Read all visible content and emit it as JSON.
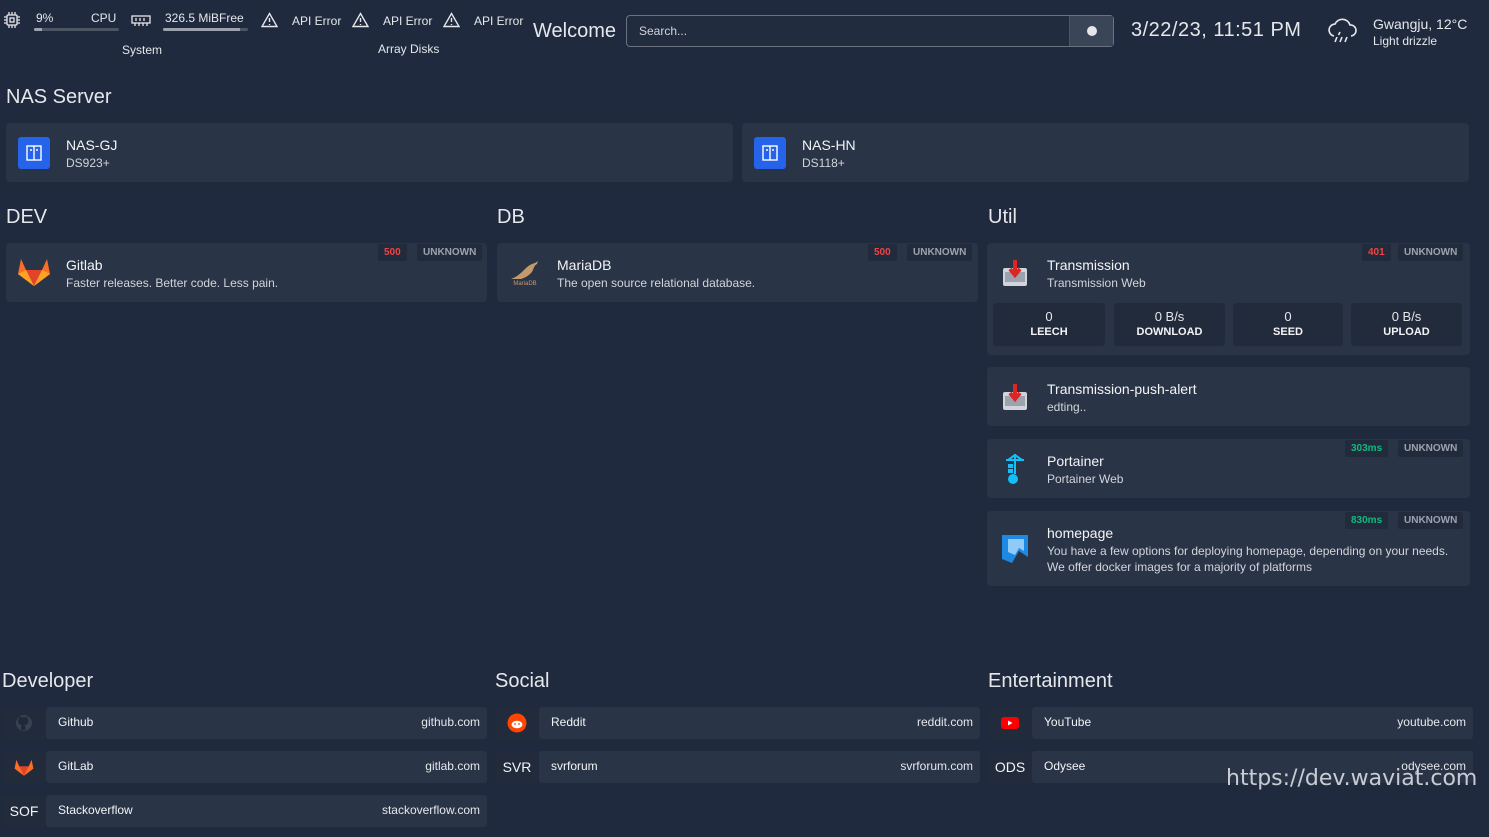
{
  "header": {
    "cpu_percent": "9%",
    "cpu_label": "CPU",
    "cpu_usage_fraction": 0.09,
    "mem_free": "326.5 MiBFree",
    "mem_usage_fraction": 0.9,
    "system_label": "System",
    "api_errors": [
      "API Error",
      "API Error",
      "API Error"
    ],
    "array_disks_label": "Array Disks",
    "greeting": "Welcome",
    "search_placeholder": "Search...",
    "datetime": "3/22/23, 11:51 PM",
    "weather_location": "Gwangju, 12°C",
    "weather_condition": "Light drizzle"
  },
  "nas": {
    "title": "NAS Server",
    "items": [
      {
        "name": "NAS-GJ",
        "model": "DS923+"
      },
      {
        "name": "NAS-HN",
        "model": "DS118+"
      }
    ]
  },
  "dev": {
    "title": "DEV",
    "items": [
      {
        "name": "Gitlab",
        "desc": "Faster releases. Better code. Less pain.",
        "code": "500",
        "status": "UNKNOWN"
      }
    ]
  },
  "db": {
    "title": "DB",
    "items": [
      {
        "name": "MariaDB",
        "desc": "The open source relational database.",
        "code": "500",
        "status": "UNKNOWN",
        "logo_text": "MariaDB"
      }
    ]
  },
  "util": {
    "title": "Util",
    "transmission": {
      "name": "Transmission",
      "desc": "Transmission Web",
      "code": "401",
      "status": "UNKNOWN",
      "stats": [
        {
          "value": "0",
          "label": "LEECH"
        },
        {
          "value": "0 B/s",
          "label": "DOWNLOAD"
        },
        {
          "value": "0",
          "label": "SEED"
        },
        {
          "value": "0 B/s",
          "label": "UPLOAD"
        }
      ]
    },
    "push_alert": {
      "name": "Transmission-push-alert",
      "desc": "edting.."
    },
    "portainer": {
      "name": "Portainer",
      "desc": "Portainer Web",
      "latency": "303ms",
      "status": "UNKNOWN"
    },
    "homepage": {
      "name": "homepage",
      "desc1": "You have a few options for deploying homepage, depending on your needs.",
      "desc2": "We offer docker images for a majority of platforms",
      "latency": "830ms",
      "status": "UNKNOWN"
    }
  },
  "developer": {
    "title": "Developer",
    "items": [
      {
        "name": "Github",
        "url": "github.com"
      },
      {
        "name": "GitLab",
        "url": "gitlab.com"
      },
      {
        "abbr": "SOF",
        "name": "Stackoverflow",
        "url": "stackoverflow.com"
      }
    ]
  },
  "social": {
    "title": "Social",
    "items": [
      {
        "name": "Reddit",
        "url": "reddit.com"
      },
      {
        "abbr": "SVR",
        "name": "svrforum",
        "url": "svrforum.com"
      }
    ]
  },
  "entertainment": {
    "title": "Entertainment",
    "items": [
      {
        "name": "YouTube",
        "url": "youtube.com"
      },
      {
        "abbr": "ODS",
        "name": "Odysee",
        "url": "odysee.com"
      }
    ]
  },
  "watermark": "https://dev.waviat.com",
  "colors": {
    "background": "#1f2a3e",
    "card": "#2a3447",
    "badge_error": "#ef4444",
    "badge_ok": "#10b981",
    "nas_icon": "#2563eb"
  }
}
